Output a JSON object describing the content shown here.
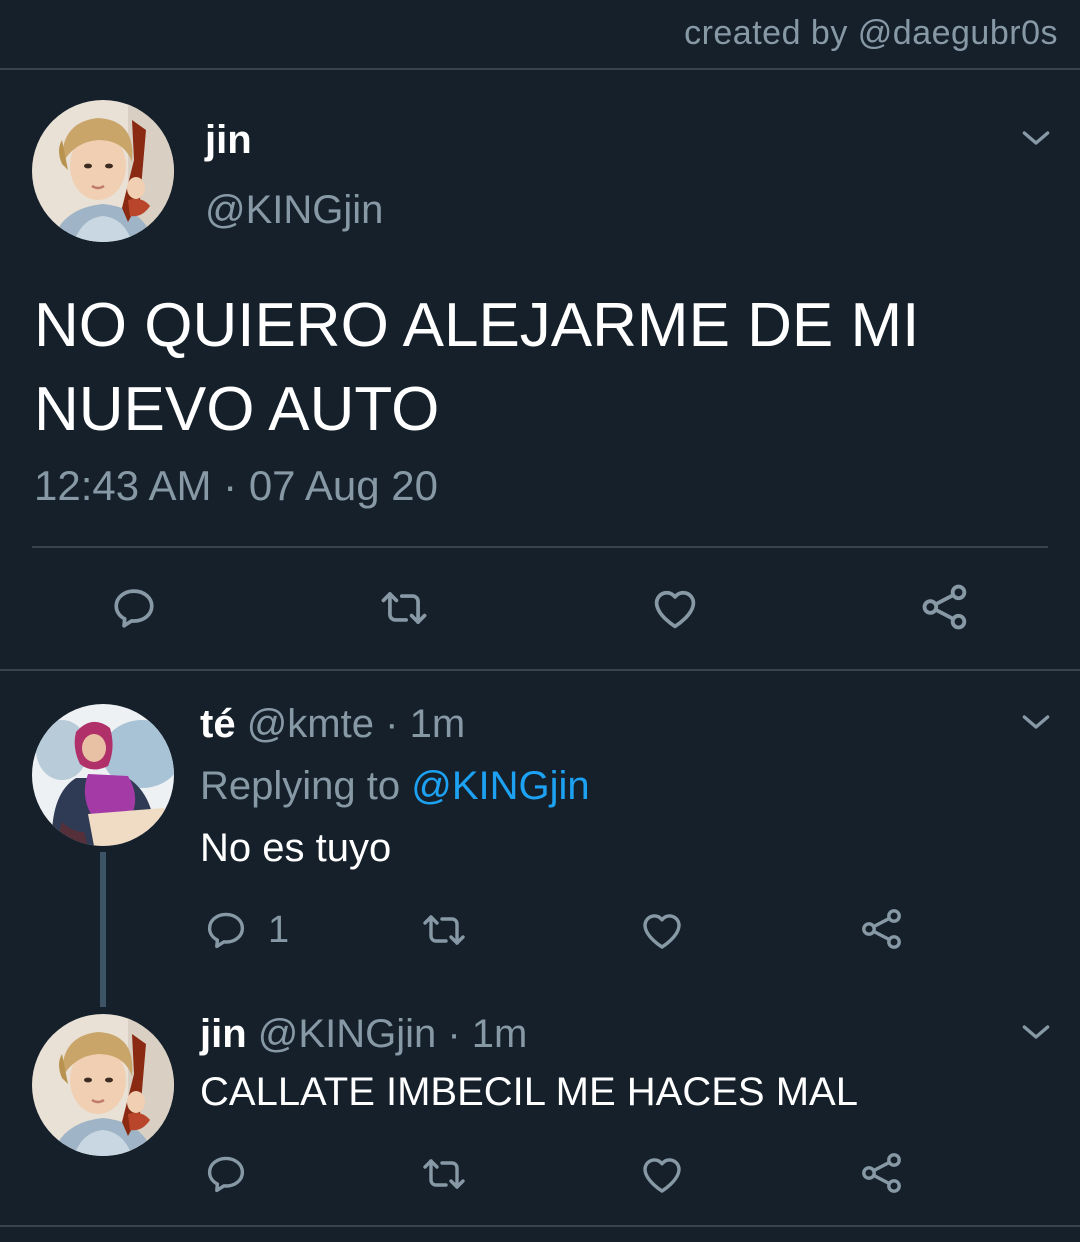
{
  "credit": "created by @daegubr0s",
  "main_tweet": {
    "name": "jin",
    "handle": "@KINGjin",
    "text": "NO QUIERO ALEJARME DE MI NUEVO AUTO",
    "time": "12:43 AM",
    "date": "07 Aug 20",
    "sep": "·",
    "actions": [
      {
        "icon": "reply-icon"
      },
      {
        "icon": "retweet-icon"
      },
      {
        "icon": "like-icon"
      },
      {
        "icon": "share-icon"
      }
    ]
  },
  "replies": [
    {
      "name": "té",
      "handle": "@kmte",
      "sep": "·",
      "time": "1m",
      "replying_prefix": "Replying to",
      "replying_to": "@KINGjin",
      "text": "No es tuyo",
      "reply_count": "1"
    },
    {
      "name": "jin",
      "handle": "@KINGjin",
      "sep": "·",
      "time": "1m",
      "text": "CALLATE IMBECIL ME HACES MAL"
    }
  ],
  "colors": {
    "background": "#15202b",
    "secondary_text": "#8899a6",
    "accent": "#1da1f2",
    "divider": "#38444d"
  }
}
